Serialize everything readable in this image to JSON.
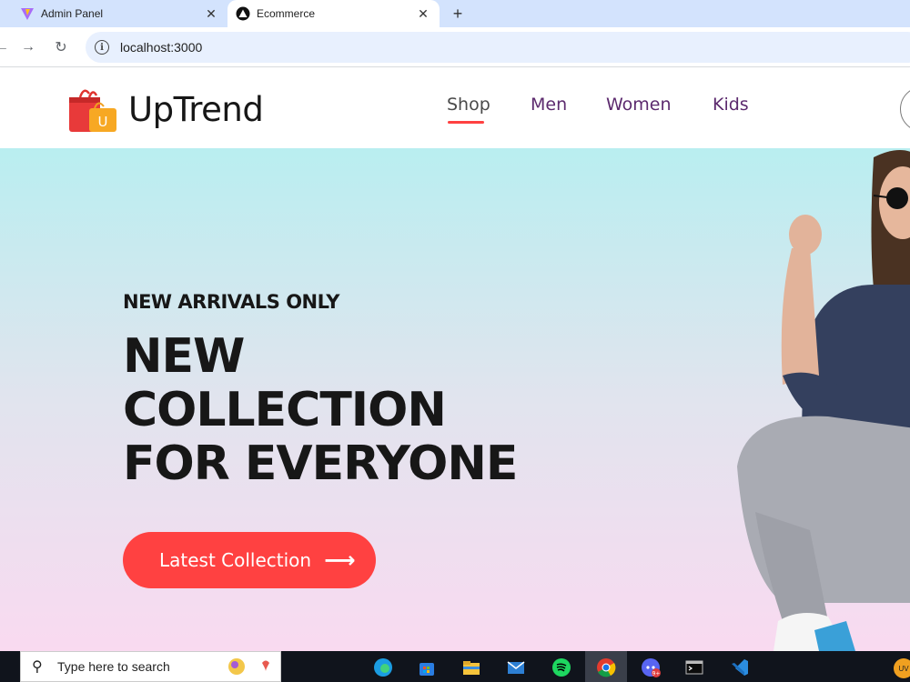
{
  "browser": {
    "tabs": [
      {
        "title": "Admin Panel",
        "icon": "vite-logo-icon",
        "active": false
      },
      {
        "title": "Ecommerce",
        "icon": "nextjs-logo-icon",
        "active": true
      }
    ],
    "close_glyph": "✕",
    "new_tab_glyph": "+",
    "url": "localhost:3000",
    "nav": {
      "back": "←",
      "forward": "→",
      "reload": "↻",
      "info": "i"
    }
  },
  "site": {
    "brand": "UpTrend",
    "logo_letter": "U",
    "menu": [
      {
        "label": "Shop",
        "active": true
      },
      {
        "label": "Men",
        "active": false
      },
      {
        "label": "Women",
        "active": false
      },
      {
        "label": "Kids",
        "active": false
      }
    ],
    "colors": {
      "accent": "#ff4141",
      "menu_text": "#5c2a6e",
      "hero_top": "#b9eef0",
      "hero_bottom": "#f9daf0"
    }
  },
  "hero": {
    "tagline": "NEW ARRIVALS ONLY",
    "title_lines": [
      "NEW",
      "COLLECTION",
      "FOR EVERYONE"
    ],
    "cta_label": "Latest Collection",
    "cta_arrow": "⟶"
  },
  "taskbar": {
    "search_placeholder": "Type here to search",
    "search_icon": "⚲",
    "apps": [
      "edge-icon",
      "store-icon",
      "file-explorer-icon",
      "mail-icon",
      "spotify-icon",
      "chrome-icon",
      "discord-icon",
      "terminal-icon",
      "vscode-icon"
    ],
    "discord_badge": "9+",
    "tray_avatar": "UV"
  }
}
